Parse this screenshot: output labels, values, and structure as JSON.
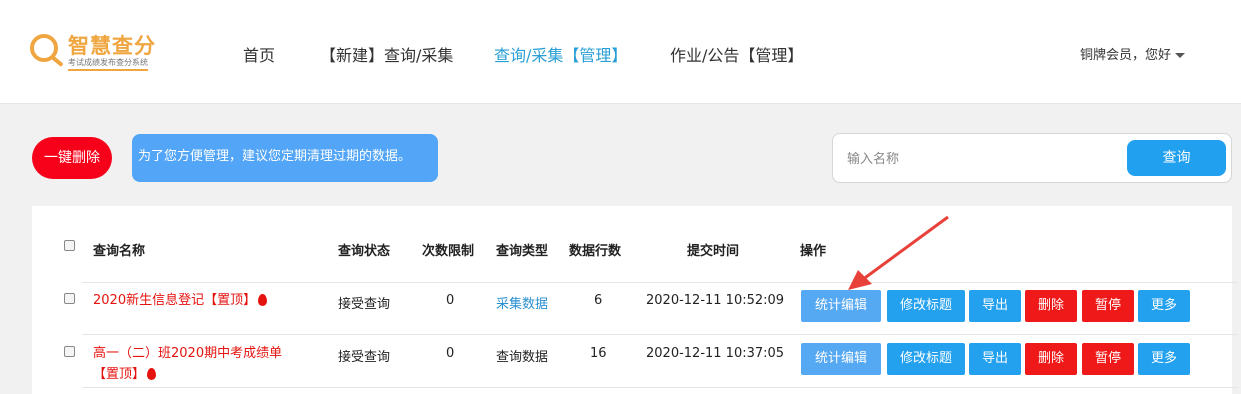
{
  "header": {
    "logo_title": "智慧查分",
    "logo_subtitle": "考试成绩发布查分系统",
    "nav": [
      "首页",
      "【新建】查询/采集",
      "查询/采集【管理】",
      "作业/公告【管理】"
    ],
    "active_nav_index": 2,
    "user_text": "铜牌会员，您好"
  },
  "toolbar": {
    "delete_all_label": "一键删除",
    "tip_text": "为了您方便管理，建议您定期清理过期的数据。",
    "search_placeholder": "输入名称",
    "search_value": "",
    "search_button": "查询"
  },
  "table": {
    "headers": [
      "查询名称",
      "查询状态",
      "次数限制",
      "查询类型",
      "数据行数",
      "提交时间",
      "操作"
    ],
    "pinned_label": "【置顶】",
    "rows": [
      {
        "name": "2020新生信息登记",
        "status": "接受查询",
        "limit": "0",
        "type": "采集数据",
        "rows": "6",
        "time": "2020-12-11 10:52:09"
      },
      {
        "name": "高一（二）班2020期中考成绩单",
        "status": "接受查询",
        "limit": "0",
        "type": "查询数据",
        "rows": "16",
        "time": "2020-12-11 10:37:05"
      }
    ],
    "actions": [
      "统计编辑",
      "修改标题",
      "导出",
      "删除",
      "暂停",
      "更多"
    ]
  },
  "colors": {
    "accent_blue": "#21a0f0",
    "danger_red": "#f01919",
    "logo_orange": "#f0a640",
    "pinned_red": "#e5130f",
    "annotation_arrow": "#e8413a"
  },
  "icons": [
    "search-logo-icon",
    "chevron-down-icon",
    "fire-icon",
    "checkbox",
    "annotation-arrow"
  ]
}
